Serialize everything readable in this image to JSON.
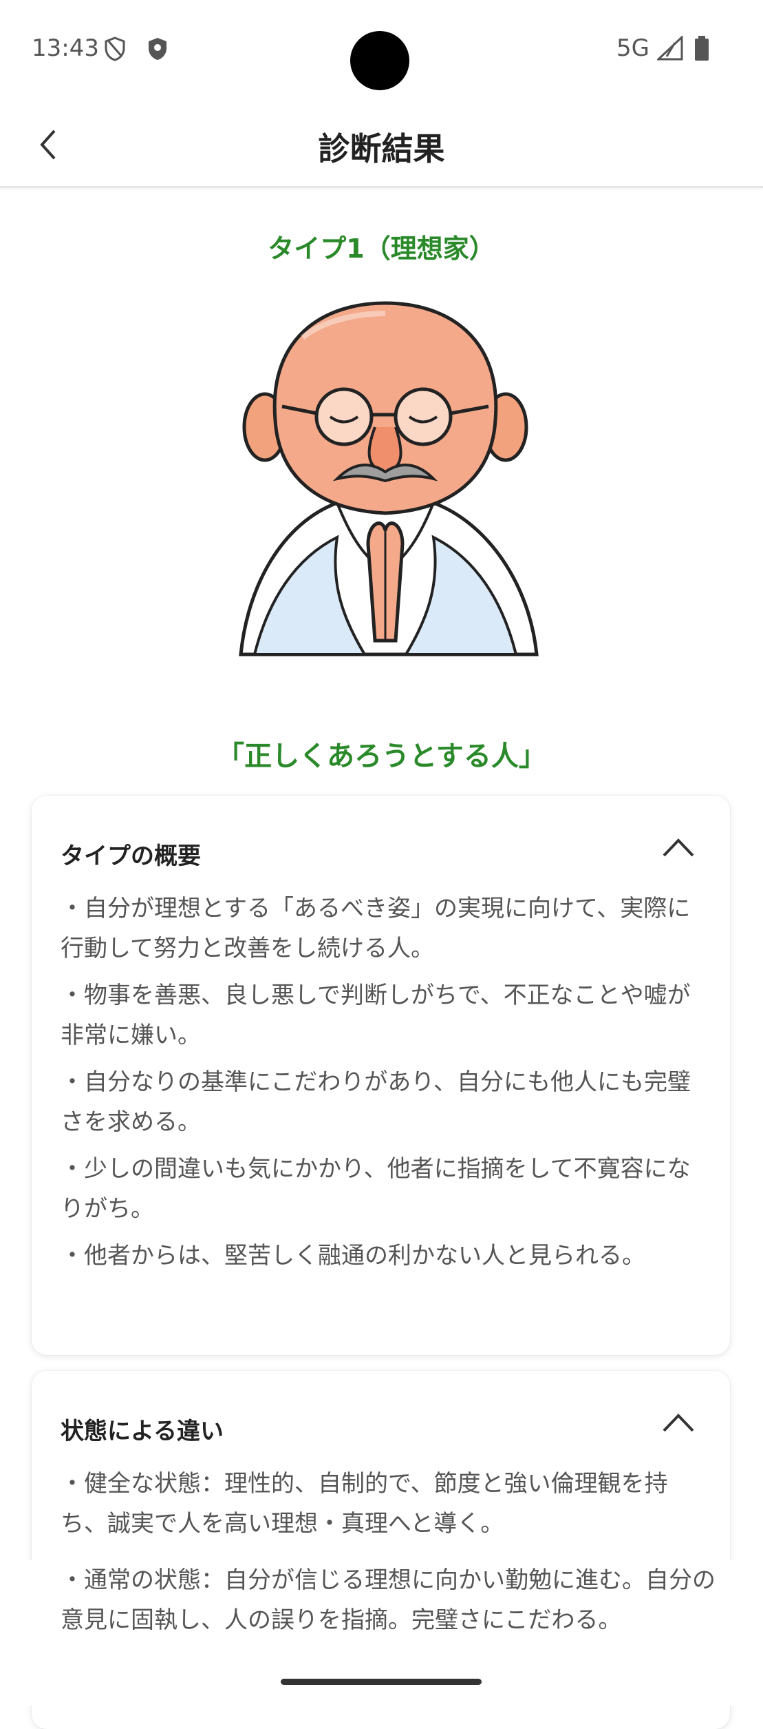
{
  "status": {
    "time": "13:43",
    "network": "5G"
  },
  "appbar": {
    "title": "診断結果"
  },
  "result": {
    "type_title": "タイプ1（理想家）",
    "catchphrase": "「正しくあろうとする人」"
  },
  "overview": {
    "heading": "タイプの概要",
    "bullets": [
      "・自分が理想とする「あるべき姿」の実現に向けて、実際に行動して努力と改善をし続ける人。",
      "・物事を善悪、良し悪しで判断しがちで、不正なことや嘘が非常に嫌い。",
      "・自分なりの基準にこだわりがあり、自分にも他人にも完璧さを求める。",
      "・少しの間違いも気にかかり、他者に指摘をして不寛容になりがち。",
      "・他者からは、堅苦しく融通の利かない人と見られる。"
    ]
  },
  "states": {
    "heading": "状態による違い",
    "bullets": [
      "・健全な状態：理性的、自制的で、節度と強い倫理観を持ち、誠実で人を高い理想・真理へと導く。",
      "・通常の状態：自分が信じる理想に向かい勤勉に進む。自分の意見に固執し、人の誤りを指摘。完璧さにこだわる。"
    ]
  },
  "colors": {
    "accent": "#2a8a2a",
    "text": "#555555"
  }
}
